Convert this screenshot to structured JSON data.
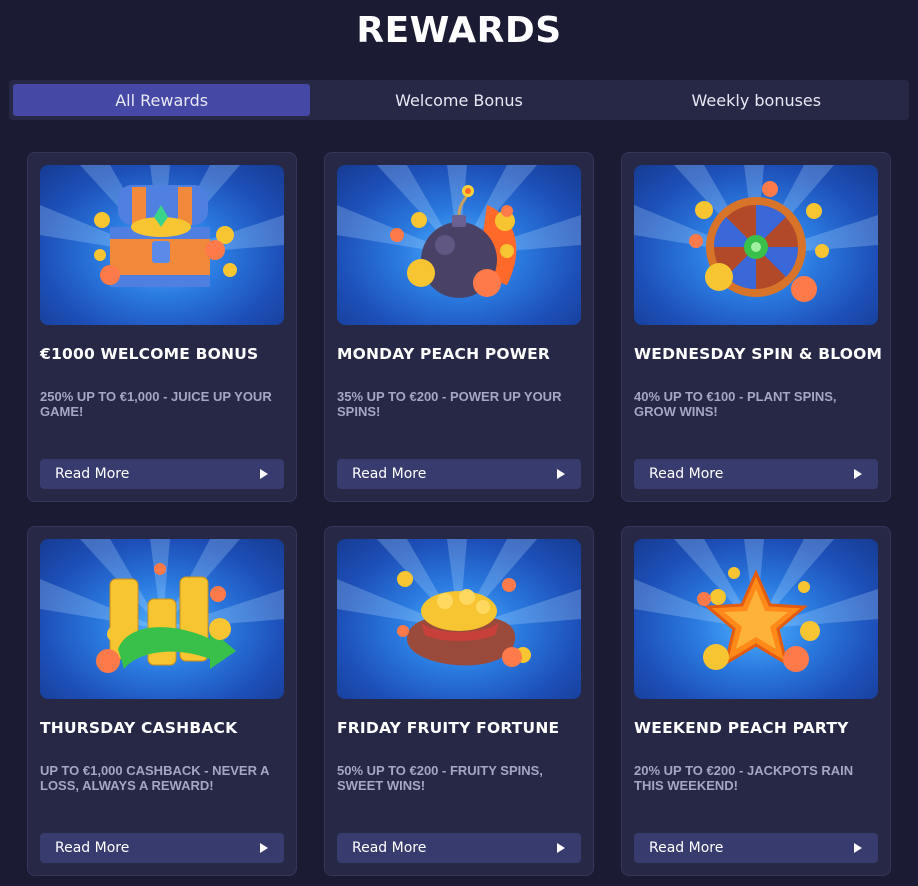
{
  "header": {
    "title": "REWARDS"
  },
  "tabs": [
    {
      "label": "All Rewards",
      "active": true
    },
    {
      "label": "Welcome Bonus",
      "active": false
    },
    {
      "label": "Weekly bonuses",
      "active": false
    }
  ],
  "cards": [
    {
      "title": "€1000 WELCOME BONUS",
      "description": "250% UP TO €1,000 - JUICE UP YOUR GAME!",
      "button": "Read More",
      "image": "treasure-chest"
    },
    {
      "title": "MONDAY PEACH POWER",
      "description": "35% UP TO €200 - POWER UP YOUR SPINS!",
      "button": "Read More",
      "image": "bomb"
    },
    {
      "title": "WEDNESDAY SPIN & BLOOM",
      "description": "40% UP TO €100 - PLANT SPINS, GROW WINS!",
      "button": "Read More",
      "image": "prize-wheel"
    },
    {
      "title": "THURSDAY CASHBACK",
      "description": "UP TO €1,000 CASHBACK - NEVER A LOSS, ALWAYS A REWARD!",
      "button": "Read More",
      "image": "coin-stacks-arrow"
    },
    {
      "title": "FRIDAY FRUITY FORTUNE",
      "description": "50% UP TO €200 - FRUITY SPINS, SWEET WINS!",
      "button": "Read More",
      "image": "coin-sack"
    },
    {
      "title": "WEEKEND PEACH PARTY",
      "description": "20% UP TO €200 - JACKPOTS RAIN THIS WEEKEND!",
      "button": "Read More",
      "image": "star"
    }
  ],
  "colors": {
    "background": "#1b1c34",
    "card": "#262846",
    "tab_active": "#4548a4",
    "button": "#383b6e",
    "description": "#a4a6c4"
  }
}
